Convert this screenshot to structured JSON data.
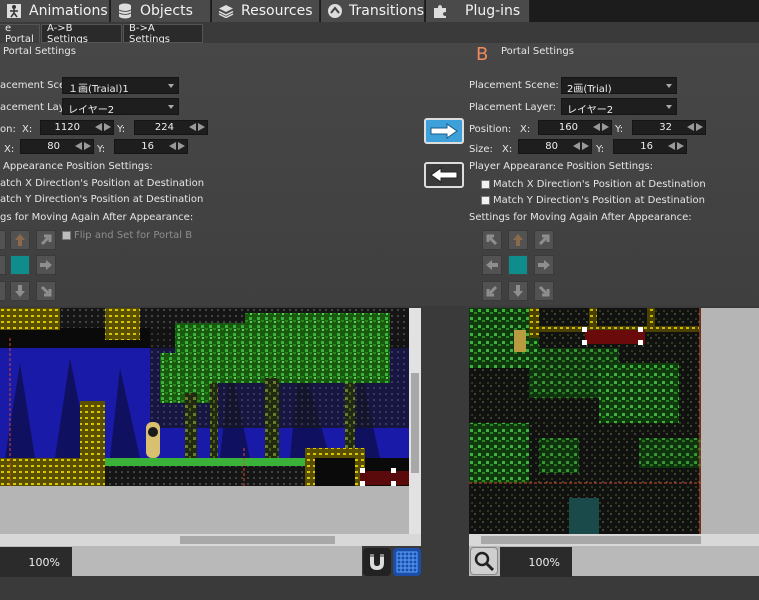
{
  "menu": {
    "tabs": [
      {
        "label": "Animations",
        "icon": "figure-icon"
      },
      {
        "label": "Objects",
        "icon": "database-icon"
      },
      {
        "label": "Resources",
        "icon": "layers-icon"
      },
      {
        "label": "Transitions",
        "icon": "transition-icon"
      },
      {
        "label": "Plug-ins",
        "icon": "puzzle-icon"
      }
    ]
  },
  "subtabs": [
    "e Portal",
    "A->B Settings",
    "B->A Settings"
  ],
  "left": {
    "header": "Portal Settings",
    "scene_label": "acement Scene:",
    "scene_value": "１画(Traial)1",
    "layer_label": "acement Layer:",
    "layer_value": "レイヤー2",
    "position_label": "on:",
    "x_label": "X:",
    "x_value": "1120",
    "y_label": "Y:",
    "y_value": "224",
    "size_x_label": "X:",
    "size_x_value": "80",
    "size_y_label": "Y:",
    "size_y_value": "16",
    "appearance_label": "Appearance Position Settings:",
    "match_x": "atch X Direction's Position at Destination",
    "match_y": "atch Y Direction's Position at Destination",
    "moving_label": "gs for Moving Again After Appearance:",
    "flip_label": "Flip and Set for Portal B",
    "zoom": "100%"
  },
  "right": {
    "letter": "B",
    "header": "Portal Settings",
    "scene_label": "Placement Scene:",
    "scene_value": "2画(Trial)",
    "layer_label": "Placement Layer:",
    "layer_value": "レイヤー2",
    "position_label": "Position:",
    "x_label": "X:",
    "x_value": "160",
    "y_label": "Y:",
    "y_value": "32",
    "size_label": "Size:",
    "size_x_label": "X:",
    "size_x_value": "80",
    "size_y_label": "Y:",
    "size_y_value": "16",
    "appearance_label": "Player Appearance Position Settings:",
    "match_x": "Match X Direction's Position at Destination",
    "match_y": "Match Y Direction's Position at Destination",
    "moving_label": "Settings for Moving Again After Appearance:",
    "zoom": "100%"
  },
  "colors": {
    "accent_b": "#f08a5d",
    "copy_right_button": "#3ea0d8",
    "center_cell": "#0f8c8c"
  },
  "icons": {
    "copy_to_right": "arrow-right-icon",
    "copy_to_left": "arrow-left-icon",
    "magnet": "magnet-icon",
    "grid": "grid-icon",
    "zoom": "magnifier-icon"
  }
}
